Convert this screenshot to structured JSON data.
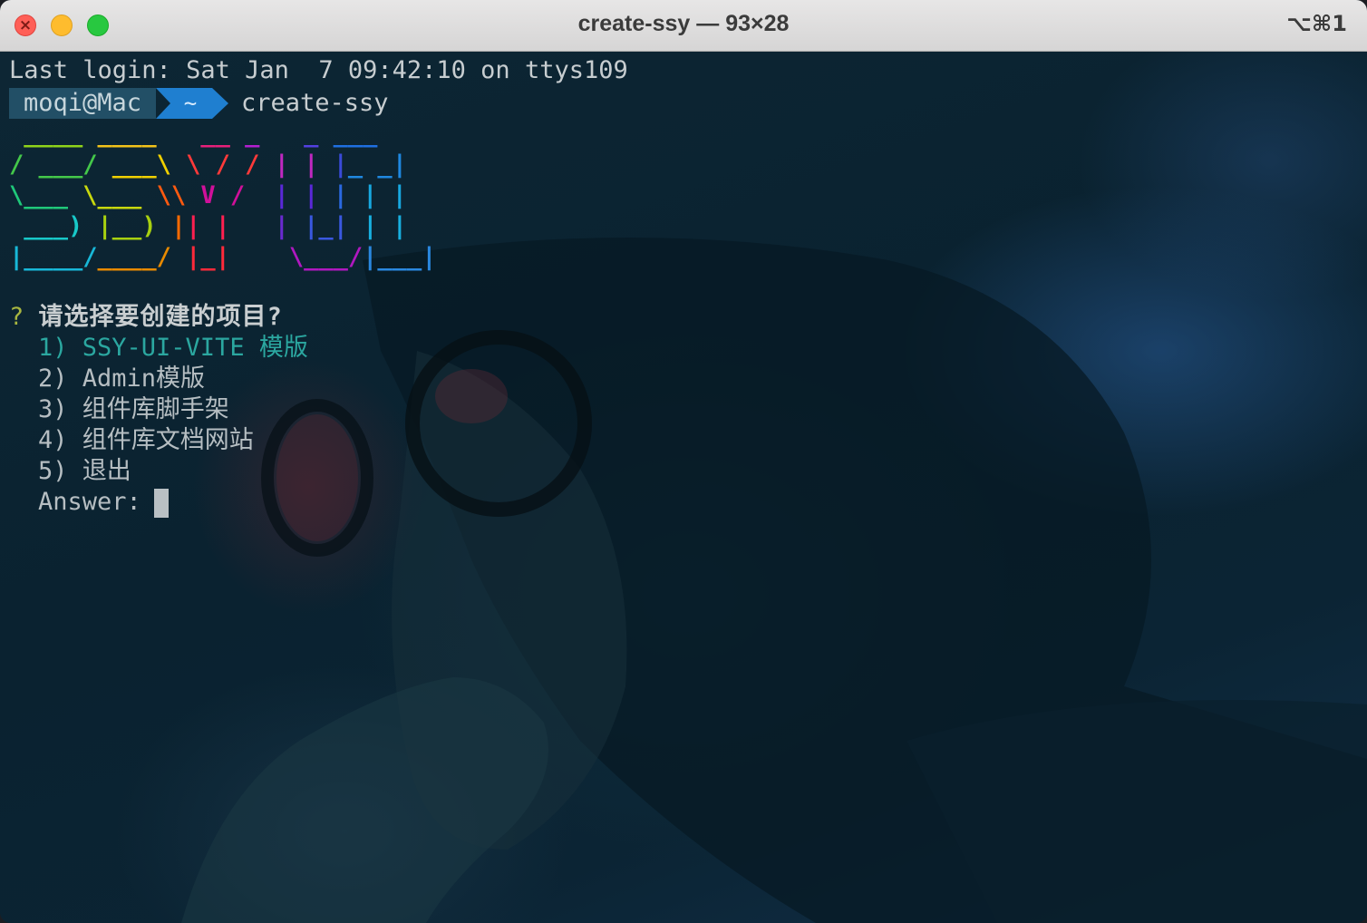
{
  "window": {
    "title": "create-ssy — 93×28",
    "shortcut": "⌥⌘1"
  },
  "terminal": {
    "last_login": "Last login: Sat Jan  7 09:42:10 on ttys109",
    "prompt_user": "moqi@Mac",
    "prompt_dir": "~",
    "command": "create-ssy",
    "banner_lines": [
      " ____ ____   __ _   _ ___ ",
      "/ ___/ ___\\ \\ / / | | |_ _|",
      "\\___ \\___ \\\\ V /  | | || | ",
      " ___) |__) || |   | |_| || | ",
      "|____/____/ |_|    \\___/|___|"
    ],
    "question_mark": "?",
    "question": "请选择要创建的项目?",
    "options": [
      "1) SSY-UI-VITE 模版",
      "2) Admin模版",
      "3) 组件库脚手架",
      "4) 组件库文档网站",
      "5) 退出"
    ],
    "answer_label": "Answer:",
    "colors": {
      "prompt_user_bg": "#224f66",
      "prompt_dir_bg": "#1f7fd0",
      "selected_option": "#2ba7a0",
      "question_mark": "#a8b640"
    }
  }
}
